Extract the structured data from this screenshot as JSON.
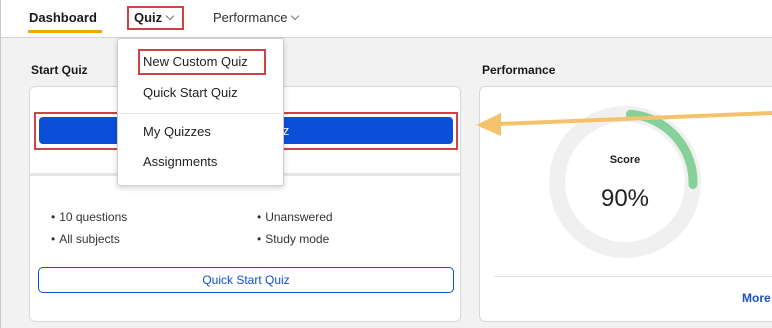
{
  "nav": {
    "dashboard": "Dashboard",
    "quiz": "Quiz",
    "performance": "Performance"
  },
  "start_quiz": {
    "title": "Start Quiz",
    "new_quiz_button_visible_text": "uiz",
    "bullets": [
      "10 questions",
      "All subjects",
      "Unanswered",
      "Study mode"
    ],
    "quick_start_button": "Quick Start Quiz"
  },
  "performance": {
    "title": "Performance",
    "score_label": "Score",
    "score_value": "90%",
    "score_fraction": 0.9,
    "more_link": "More"
  },
  "quiz_menu": {
    "items": [
      "New Custom Quiz",
      "Quick Start Quiz",
      "My Quizzes",
      "Assignments"
    ]
  },
  "colors": {
    "accent_orange": "#f0a500",
    "highlight_red": "#d24242",
    "primary_blue": "#0b4fd9",
    "gauge_green": "#86d19a",
    "annotation_arrow": "#f5c26b"
  }
}
